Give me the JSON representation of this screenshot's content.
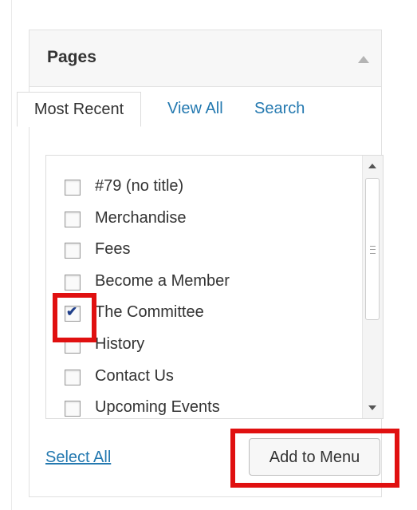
{
  "panel": {
    "title": "Pages",
    "toggle_icon": "arrow-up-icon"
  },
  "tabs": [
    {
      "label": "Most Recent",
      "active": true
    },
    {
      "label": "View All",
      "active": false
    },
    {
      "label": "Search",
      "active": false
    }
  ],
  "items": [
    {
      "label": "#79 (no title)",
      "checked": false
    },
    {
      "label": "Merchandise",
      "checked": false
    },
    {
      "label": "Fees",
      "checked": false
    },
    {
      "label": "Become a Member",
      "checked": false
    },
    {
      "label": "The Committee",
      "checked": true
    },
    {
      "label": "History",
      "checked": false
    },
    {
      "label": "Contact Us",
      "checked": false
    },
    {
      "label": "Upcoming Events",
      "checked": false
    }
  ],
  "footer": {
    "select_all_label": "Select All",
    "add_button_label": "Add to Menu"
  },
  "colors": {
    "link": "#2479b0",
    "highlight": "#e01010",
    "check": "#1f3f8a"
  }
}
